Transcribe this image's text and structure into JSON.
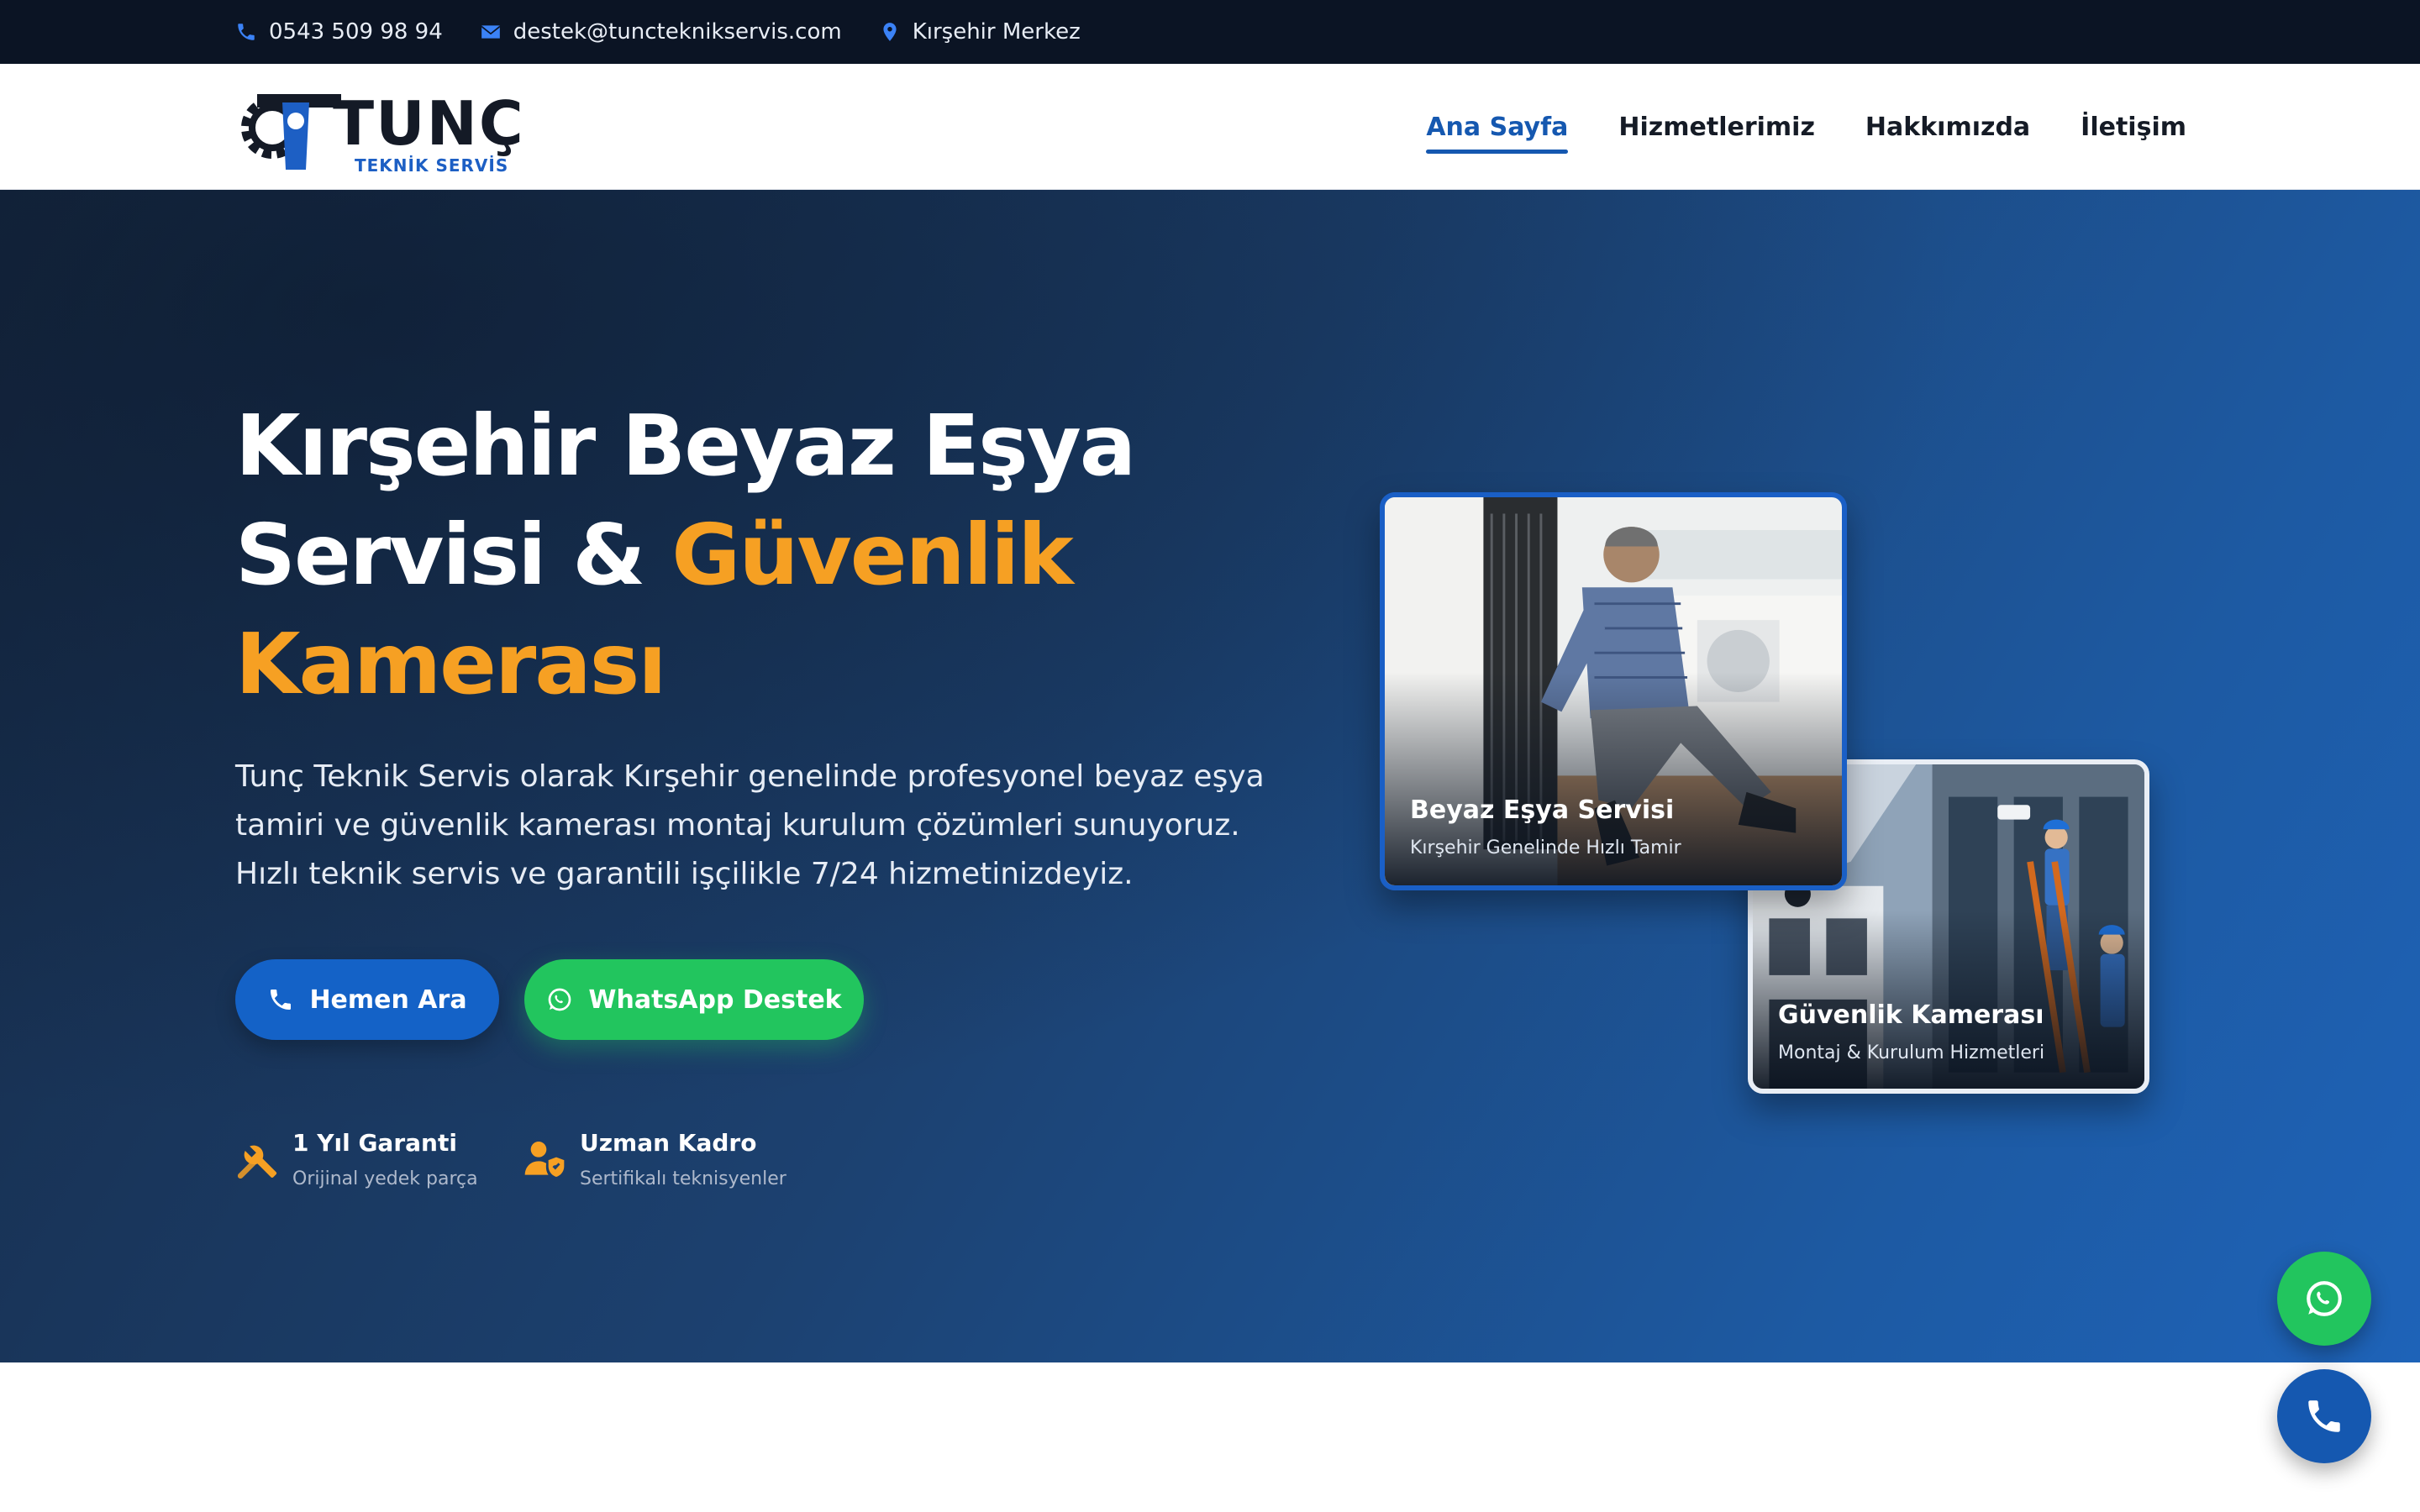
{
  "topbar": {
    "phone": "0543 509 98 94",
    "email": "destek@tuncteknikservis.com",
    "location": "Kırşehir Merkez"
  },
  "logo": {
    "name": "TUNÇ",
    "sub": "TEKNİK SERVİS"
  },
  "nav": {
    "items": [
      {
        "label": "Ana Sayfa",
        "active": true
      },
      {
        "label": "Hizmetlerimiz"
      },
      {
        "label": "Hakkımızda"
      },
      {
        "label": "İletişim"
      }
    ]
  },
  "hero": {
    "title_line1": "Kırşehir Beyaz Eşya",
    "title_line2_white": "Servisi & ",
    "title_line2_accent": "Güvenlik",
    "title_line3_accent": "Kamerası",
    "description": "Tunç Teknik Servis olarak Kırşehir genelinde profesyonel beyaz eşya tamiri ve güvenlik kamerası montaj kurulum çözümleri sunuyoruz. Hızlı teknik servis ve garantili işçilikle 7/24 hizmetinizdeyiz.",
    "btn_call": "Hemen Ara",
    "btn_whatsapp": "WhatsApp Destek",
    "features": [
      {
        "title": "1 Yıl Garanti",
        "subtitle": "Orijinal yedek parça",
        "icon": "tools-icon"
      },
      {
        "title": "Uzman Kadro",
        "subtitle": "Sertifikalı teknisyenler",
        "icon": "user-shield-icon"
      }
    ]
  },
  "cards": [
    {
      "title": "Beyaz Eşya Servisi",
      "subtitle": "Kırşehir Genelinde Hızlı Tamir"
    },
    {
      "title": "Güvenlik Kamerası",
      "subtitle": "Montaj & Kurulum Hizmetleri"
    }
  ],
  "colors": {
    "accent": "#f6a023",
    "primary": "#1558b0",
    "whatsapp": "#22c55e",
    "topbar": "#0b1424"
  }
}
